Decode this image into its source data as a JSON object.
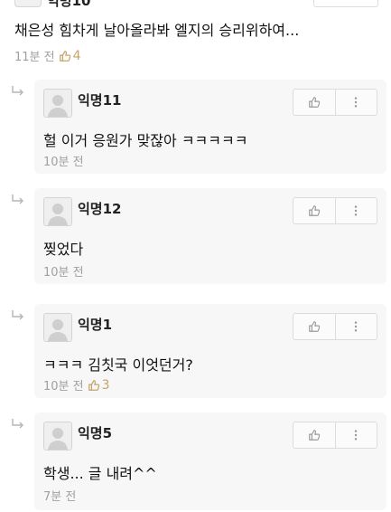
{
  "parent": {
    "nickname": "익명10",
    "text": "채은성 힘차게 날아올라봐 엘지의 승리위하여...",
    "time": "11분 전",
    "likes": "4"
  },
  "replies": [
    {
      "nickname": "익명11",
      "text": "헐 이거 응원가 맞잖아 ㅋㅋㅋㅋㅋ",
      "time": "10분 전",
      "likes": ""
    },
    {
      "nickname": "익명12",
      "text": "찢었다",
      "time": "10분 전",
      "likes": ""
    },
    {
      "nickname": "익명1",
      "text": "ㅋㅋㅋ 김칫국 이엇던거?",
      "time": "10분 전",
      "likes": "3"
    },
    {
      "nickname": "익명5",
      "text": "학생... 글 내려^^",
      "time": "7분 전",
      "likes": ""
    }
  ],
  "icons": {
    "like": "thumbs-up-icon",
    "more": "more-vertical-icon",
    "reply": "reply-arrow-icon",
    "avatar": "default-avatar-icon"
  },
  "colors": {
    "bubble": "#f7f7f8",
    "meta": "#a0a0a0",
    "like_accent": "#c5a46a"
  }
}
